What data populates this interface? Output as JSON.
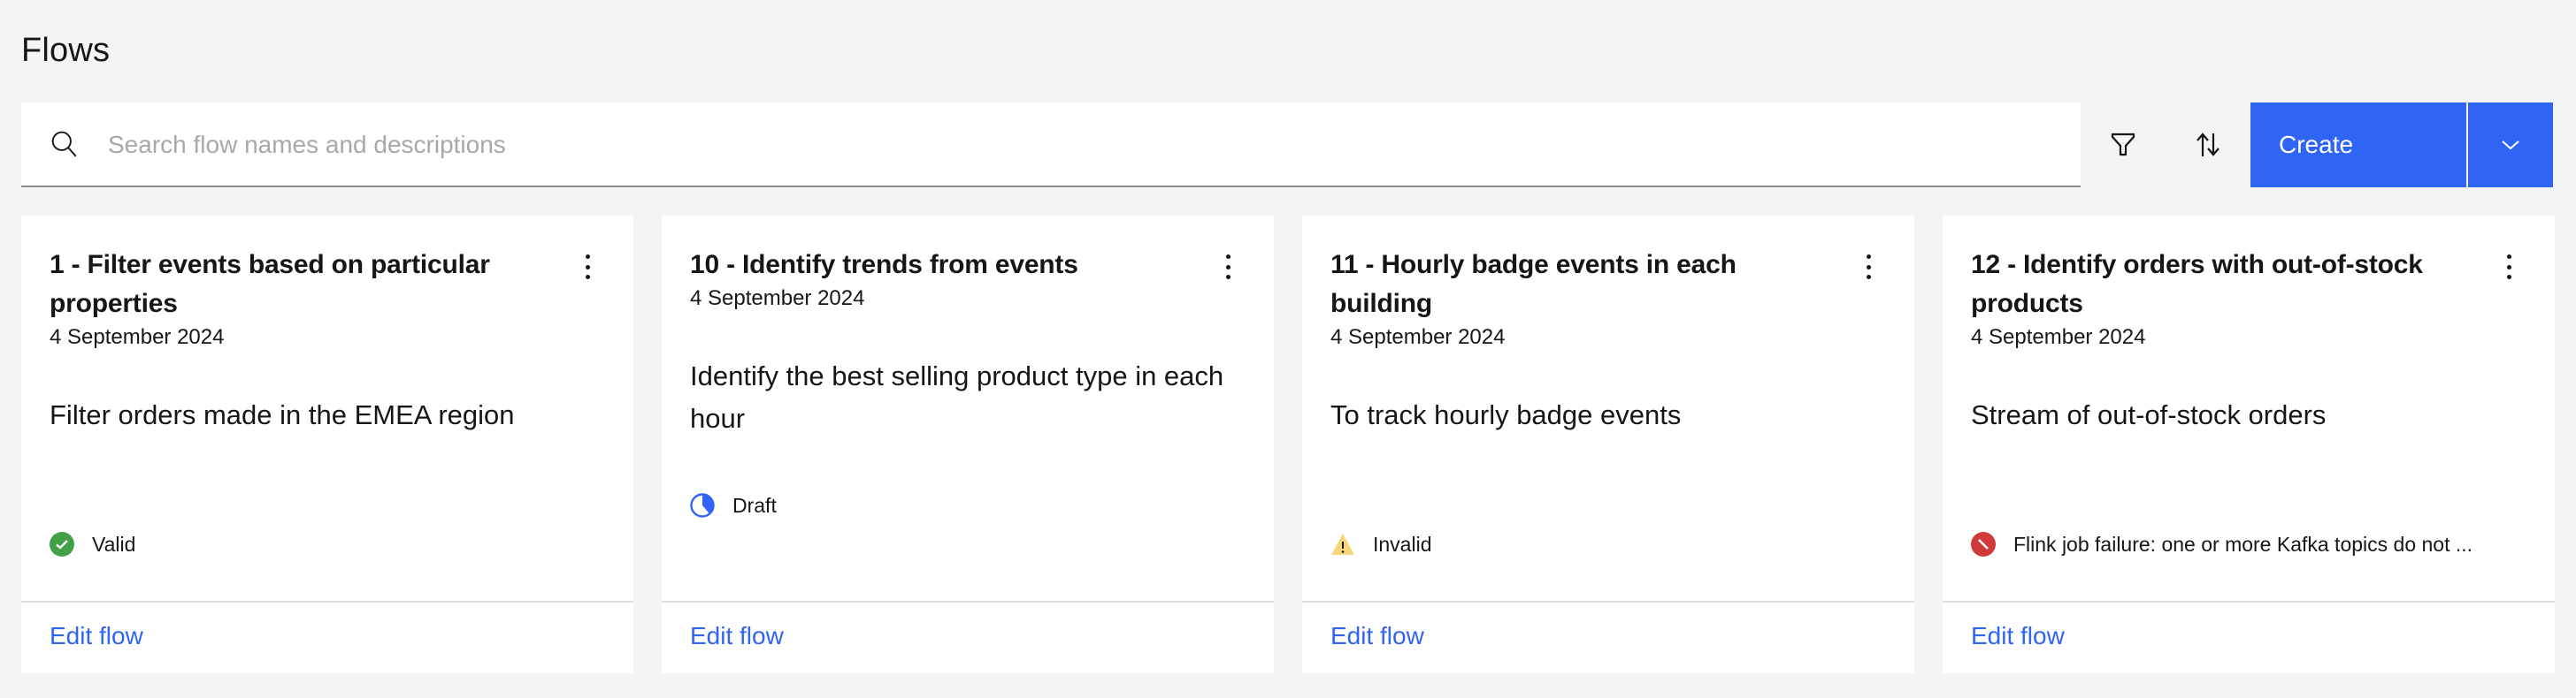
{
  "page": {
    "title": "Flows"
  },
  "toolbar": {
    "search_placeholder": "Search flow names and descriptions",
    "search_value": "",
    "filter_icon": "filter-icon",
    "sort_icon": "sort-arrows-icon",
    "create_label": "Create",
    "create_menu_icon": "chevron-down-icon",
    "accent_color": "#2f64f5"
  },
  "flows": [
    {
      "title": "1 - Filter events based on particular properties",
      "date": "4 September 2024",
      "description": "Filter orders made in the EMEA region",
      "status": {
        "label": "Valid",
        "icon": "checkmark-filled-icon",
        "color": "#42a048"
      },
      "action": "Edit flow"
    },
    {
      "title": "10 - Identify trends from events",
      "date": "4 September 2024",
      "description": "Identify the best selling product type in each hour",
      "status": {
        "label": "Draft",
        "icon": "incomplete-icon",
        "color": "#2f64f5"
      },
      "action": "Edit flow"
    },
    {
      "title": "11 - Hourly badge events in each building",
      "date": "4 September 2024",
      "description": "To track hourly badge events",
      "status": {
        "label": "Invalid",
        "icon": "warning-triangle-icon",
        "color": "#f1c21b"
      },
      "action": "Edit flow"
    },
    {
      "title": "12 - Identify orders with out-of-stock products",
      "date": "4 September 2024",
      "description": "Stream of out-of-stock orders",
      "status": {
        "label": "Flink job failure: one or more Kafka topics do not ...",
        "icon": "error-blocked-icon",
        "color": "#d03a3a"
      },
      "action": "Edit flow"
    }
  ]
}
